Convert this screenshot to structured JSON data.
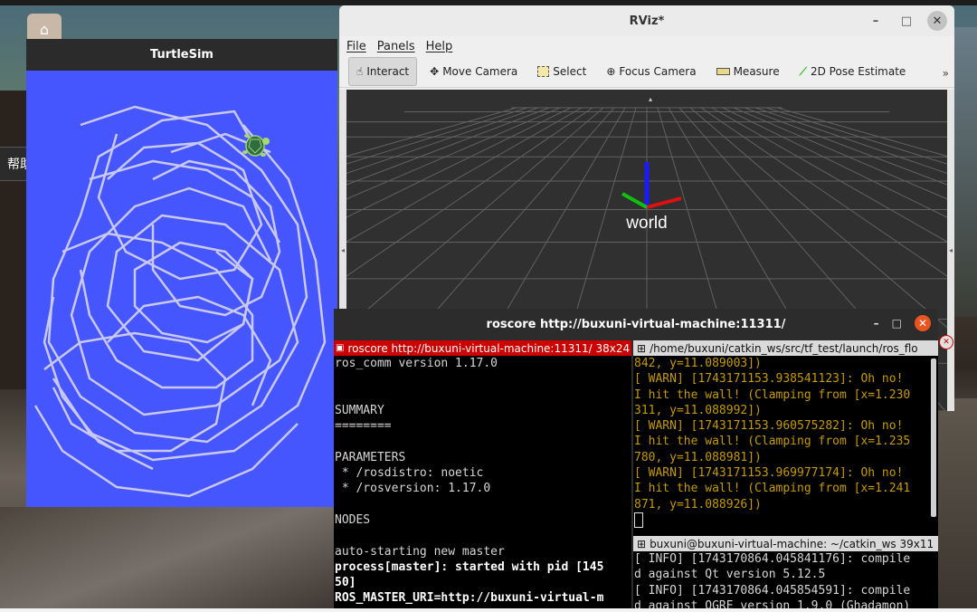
{
  "desktop": {
    "help_label": "帮助"
  },
  "turtlesim": {
    "title": "TurtleSim",
    "background_color": "#4556ff",
    "trail_color": "#c8c8f0"
  },
  "rviz": {
    "title": "RViz*",
    "menu": [
      "File",
      "Panels",
      "Help"
    ],
    "tools": [
      {
        "label": "Interact",
        "icon": "hand-pointer-icon",
        "active": true
      },
      {
        "label": "Move Camera",
        "icon": "move-camera-icon",
        "active": false
      },
      {
        "label": "Select",
        "icon": "select-box-icon",
        "active": false
      },
      {
        "label": "Focus Camera",
        "icon": "focus-target-icon",
        "active": false
      },
      {
        "label": "Measure",
        "icon": "ruler-icon",
        "active": false
      },
      {
        "label": "2D Pose Estimate",
        "icon": "pose-arrow-icon",
        "active": false
      }
    ],
    "more_label": "»",
    "frame_label": "world"
  },
  "roscore": {
    "title": "roscore http://buxuni-virtual-machine:11311/",
    "left_pane": {
      "header": "roscore http://buxuni-virtual-machine:11311/ 38x24",
      "lines": [
        {
          "text": "ros_comm version 1.17.0",
          "bold": false
        },
        {
          "text": "",
          "bold": false
        },
        {
          "text": "",
          "bold": false
        },
        {
          "text": "SUMMARY",
          "bold": false
        },
        {
          "text": "========",
          "bold": false
        },
        {
          "text": "",
          "bold": false
        },
        {
          "text": "PARAMETERS",
          "bold": false
        },
        {
          "text": " * /rosdistro: noetic",
          "bold": false
        },
        {
          "text": " * /rosversion: 1.17.0",
          "bold": false
        },
        {
          "text": "",
          "bold": false
        },
        {
          "text": "NODES",
          "bold": false
        },
        {
          "text": "",
          "bold": false
        },
        {
          "text": "auto-starting new master",
          "bold": false
        },
        {
          "text": "process[master]: started with pid [145",
          "bold": true
        },
        {
          "text": "50]",
          "bold": true
        },
        {
          "text": "ROS_MASTER_URI=http://buxuni-virtual-m",
          "bold": true
        }
      ]
    },
    "right_top_pane": {
      "header": "/home/buxuni/catkin_ws/src/tf_test/launch/ros_flo",
      "lines": [
        "842, y=11.089003])",
        "[ WARN] [1743171153.938541123]: Oh no!",
        "I hit the wall! (Clamping from [x=1.230",
        "311, y=11.088992])",
        "[ WARN] [1743171153.960575282]: Oh no!",
        "I hit the wall! (Clamping from [x=1.235",
        "780, y=11.088981])",
        "[ WARN] [1743171153.969977174]: Oh no!",
        "I hit the wall! (Clamping from [x=1.241",
        "871, y=11.088926])"
      ]
    },
    "right_bottom_pane": {
      "header": "buxuni@buxuni-virtual-machine: ~/catkin_ws 39x11",
      "lines": [
        "[ INFO] [1743170864.045841176]: compile",
        "d against Qt version 5.12.5",
        "[ INFO] [1743170864.045854591]: compile",
        "d against OGRE version 1.9.0 (Ghadamon)"
      ]
    }
  }
}
